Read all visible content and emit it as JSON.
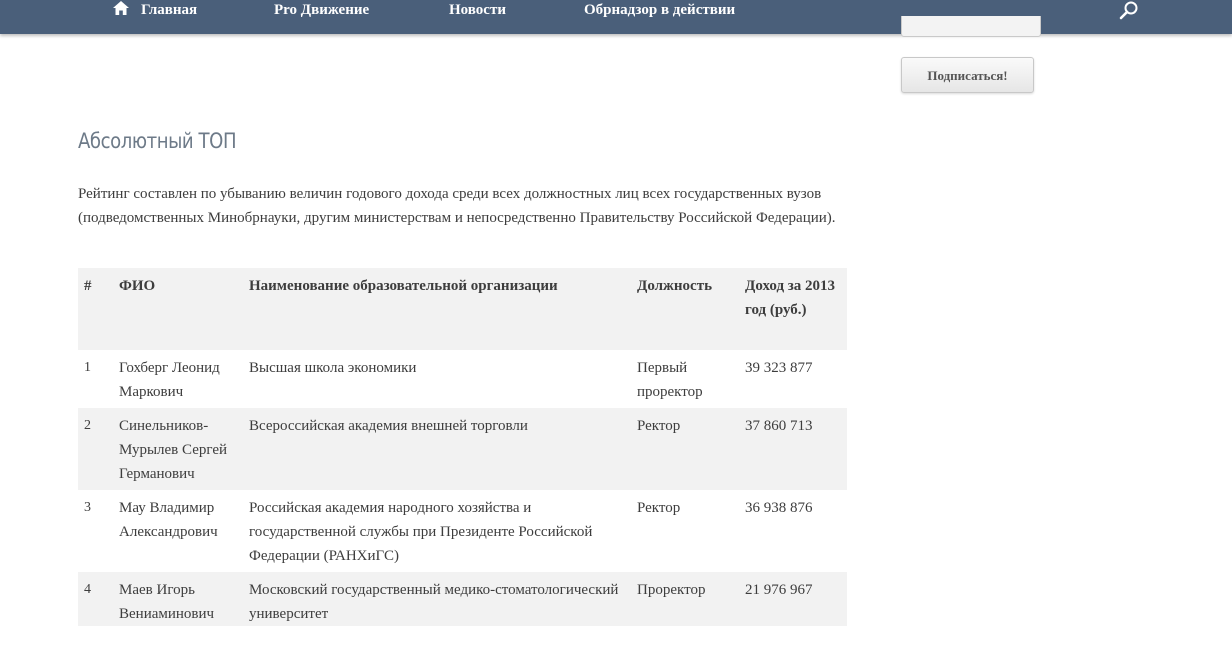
{
  "nav": {
    "items": [
      {
        "label": "Главная",
        "icon": "home-icon"
      },
      {
        "label": "Pro Движение"
      },
      {
        "label": "Новости"
      },
      {
        "label": "Обрнадзор в действии"
      }
    ],
    "search_icon": "search-icon",
    "bar_color": "#4a5f7a"
  },
  "sidebar": {
    "subscribe_label": "Подписаться!"
  },
  "main": {
    "title": "Абсолютный ТОП",
    "intro": "Рейтинг составлен по убыванию величин годового дохода среди всех должностных лиц всех государственных вузов (подведомственных Минобрнауки, другим министерствам и непосредственно Правительству Российской Федерации).",
    "table": {
      "headers": [
        "#",
        "ФИО",
        "Наименование образовательной организации",
        "Должность",
        "Доход за 2013 год (руб.)"
      ],
      "rows": [
        {
          "num": "1",
          "name": "Гохберг Леонид Маркович",
          "org": "Высшая школа экономики",
          "position": "Первый проректор",
          "income": "39 323 877"
        },
        {
          "num": "2",
          "name": "Синельников-Мурылев Сергей Германович",
          "org": "Всероссийская академия внешней торговли",
          "position": "Ректор",
          "income": "37 860 713"
        },
        {
          "num": "3",
          "name": "Мау Владимир Александрович",
          "org": "Российская академия народного хозяйства и государственной службы при Президенте Российской Федерации (РАНХиГС)",
          "position": "Ректор",
          "income": "36 938 876"
        },
        {
          "num": "4",
          "name": "Маев Игорь Вениаминович",
          "org": "Московский государственный медико-стоматологический университет",
          "position": "Проректор",
          "income": "21 976 967"
        }
      ]
    }
  }
}
